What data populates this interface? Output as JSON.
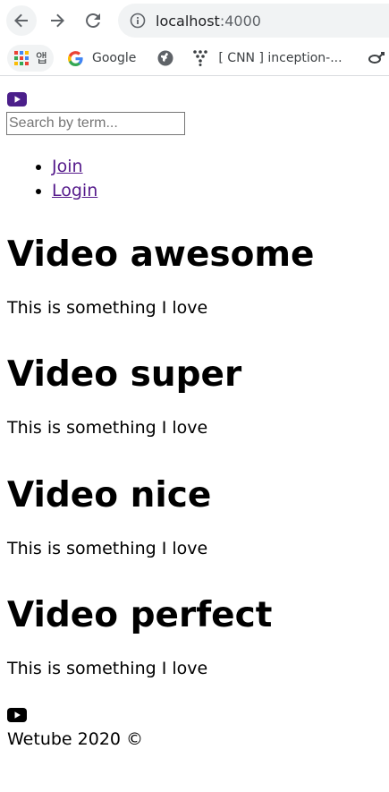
{
  "browser": {
    "url_host": "localhost",
    "url_port": ":4000",
    "bookmarks": [
      {
        "label": "앱",
        "icon": "apps-grid-icon"
      },
      {
        "label": "Google",
        "icon": "google-icon"
      },
      {
        "label": "",
        "icon": "globe-icon"
      },
      {
        "label": "[ CNN ] inception-...",
        "icon": "tensorflow-icon"
      },
      {
        "label": "",
        "icon": "extension-icon"
      }
    ]
  },
  "header": {
    "logo_icon": "youtube-icon",
    "search": {
      "placeholder": "Search by term...",
      "value": ""
    },
    "nav": [
      {
        "label": "Join"
      },
      {
        "label": "Login"
      }
    ]
  },
  "videos": [
    {
      "title": "Video awesome",
      "description": "This is something I love"
    },
    {
      "title": "Video super",
      "description": "This is something I love"
    },
    {
      "title": "Video nice",
      "description": "This is something I love"
    },
    {
      "title": "Video perfect",
      "description": "This is something I love"
    }
  ],
  "footer": {
    "icon": "youtube-icon",
    "text": "Wetube 2020 ©"
  },
  "colors": {
    "link_visited": "#551a8b",
    "logo_purple": "#4b1f8a",
    "chrome_bg": "#f1f3f4"
  }
}
